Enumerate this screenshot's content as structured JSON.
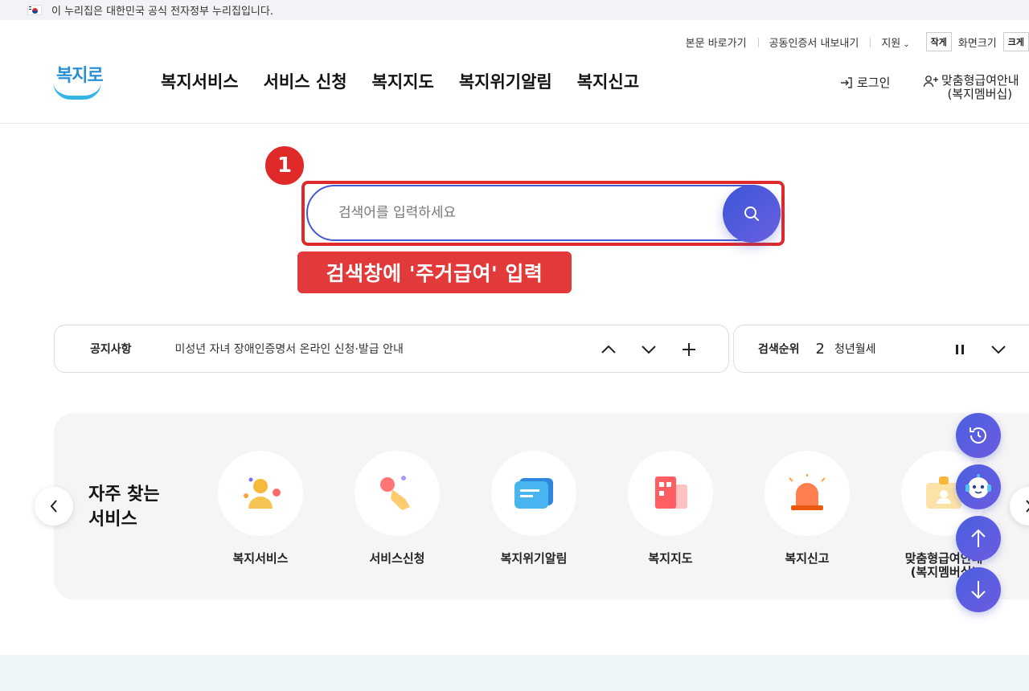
{
  "gov_banner": {
    "text": "이 누리집은 대한민국 공식 전자정부 누리집입니다."
  },
  "utility": {
    "skip_link": "본문 바로가기",
    "cert_export": "공동인증서 내보내기",
    "support": "지원",
    "size_small": "작게",
    "size_label": "화면크기",
    "size_large": "크게"
  },
  "logo": {
    "text": "복지로"
  },
  "gnb": {
    "items": [
      "복지서비스",
      "서비스 신청",
      "복지지도",
      "복지위기알림",
      "복지신고"
    ]
  },
  "header_right": {
    "login": "로그인",
    "membership_line1": "맞춤형급여안내",
    "membership_line2": "(복지멤버십)"
  },
  "annotation": {
    "step": "1",
    "callout": "검색창에 '주거급여' 입력"
  },
  "search": {
    "placeholder": "검색어를 입력하세요",
    "value": ""
  },
  "notice": {
    "label": "공지사항",
    "text": "미성년 자녀 장애인증명서 온라인 신청·발급 안내"
  },
  "rank": {
    "label": "검색순위",
    "number": "2",
    "text": "청년월세"
  },
  "favorites": {
    "title_line1": "자주 찾는",
    "title_line2": "서비스",
    "items": [
      {
        "label": "복지서비스"
      },
      {
        "label": "서비스신청"
      },
      {
        "label": "복지위기알림"
      },
      {
        "label": "복지지도"
      },
      {
        "label": "복지신고"
      },
      {
        "label_line1": "맞춤형급여안내",
        "label_line2": "(복지멤버십)"
      }
    ]
  }
}
